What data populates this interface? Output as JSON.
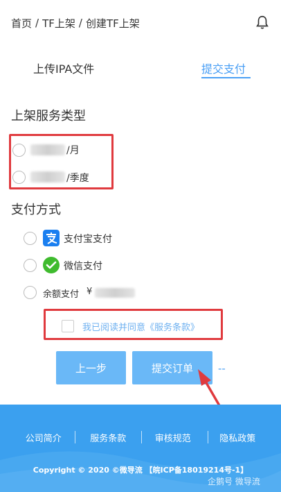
{
  "breadcrumb": {
    "items": [
      "首页",
      "TF上架",
      "创建TF上架"
    ],
    "separator": "/"
  },
  "tabs": [
    {
      "label": "上传IPA文件",
      "active": false
    },
    {
      "label": "提交支付",
      "active": true
    }
  ],
  "service_type": {
    "title": "上架服务类型",
    "options": [
      {
        "suffix": "/月",
        "selected": false
      },
      {
        "suffix": "/季度",
        "selected": false
      }
    ]
  },
  "payment": {
    "title": "支付方式",
    "methods": [
      {
        "label": "支付宝支付",
        "icon": "alipay-icon",
        "color": "#1a7ff0"
      },
      {
        "label": "微信支付",
        "icon": "wechat-icon",
        "color": "#3fbb2e"
      },
      {
        "label": "余额支付",
        "icon": null,
        "balance_prefix": "¥"
      }
    ]
  },
  "agreement": {
    "text": "我已阅读并同意《服务条款》",
    "checked": false
  },
  "buttons": {
    "prev": "上一步",
    "submit": "提交订单",
    "dash": "--"
  },
  "footer": {
    "links": [
      "公司简介",
      "服务条款",
      "审核规范",
      "隐私政策"
    ],
    "copyright": "Copyright © 2020 ©微导流 【皖ICP备18019214号-1】",
    "watermark": "企鹅号 微导流"
  },
  "colors": {
    "accent": "#4a9ff5",
    "button": "#6ab8f7",
    "footer": "#3ba0ef",
    "highlight": "#e03a3e"
  }
}
